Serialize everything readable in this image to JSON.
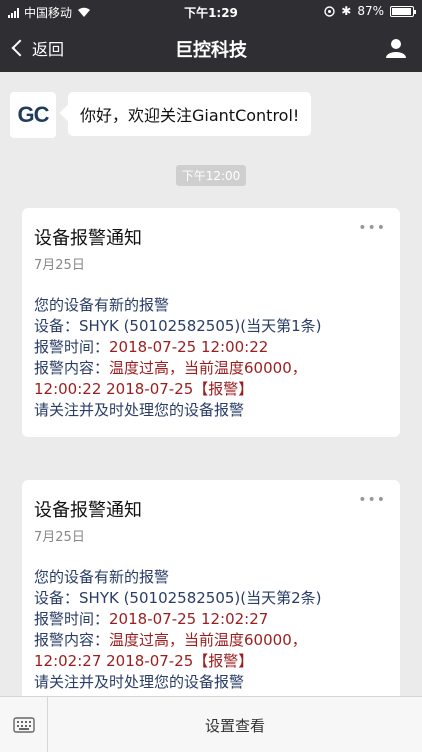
{
  "status_bar": {
    "carrier": "中国移动",
    "time": "下午1:29",
    "battery": "87%",
    "battery_level": 0.87
  },
  "nav": {
    "back_label": "返回",
    "title": "巨控科技"
  },
  "welcome": {
    "avatar_text": "GC",
    "message": "你好，欢迎关注GiantControl!"
  },
  "timestamp": "下午12:00",
  "cards": [
    {
      "title": "设备报警通知",
      "date": "7月25日",
      "line1": "您的设备有新的报警",
      "device_label": "设备：",
      "device_value": "SHYK (50102582505)(当天第1条)",
      "time_label": "报警时间：",
      "time_value": "2018-07-25 12:00:22",
      "content_label": "报警内容：",
      "content_value": "温度过高，当前温度60000，",
      "content_line2": "12:00:22 2018-07-25【报警】",
      "footer": "请关注并及时处理您的设备报警"
    },
    {
      "title": "设备报警通知",
      "date": "7月25日",
      "line1": "您的设备有新的报警",
      "device_label": "设备：",
      "device_value": "SHYK (50102582505)(当天第2条)",
      "time_label": "报警时间：",
      "time_value": "2018-07-25 12:02:27",
      "content_label": "报警内容：",
      "content_value": "温度过高，当前温度60000，",
      "content_line2": "12:02:27 2018-07-25【报警】",
      "footer": "请关注并及时处理您的设备报警"
    }
  ],
  "bottom": {
    "menu_label": "设置查看"
  }
}
